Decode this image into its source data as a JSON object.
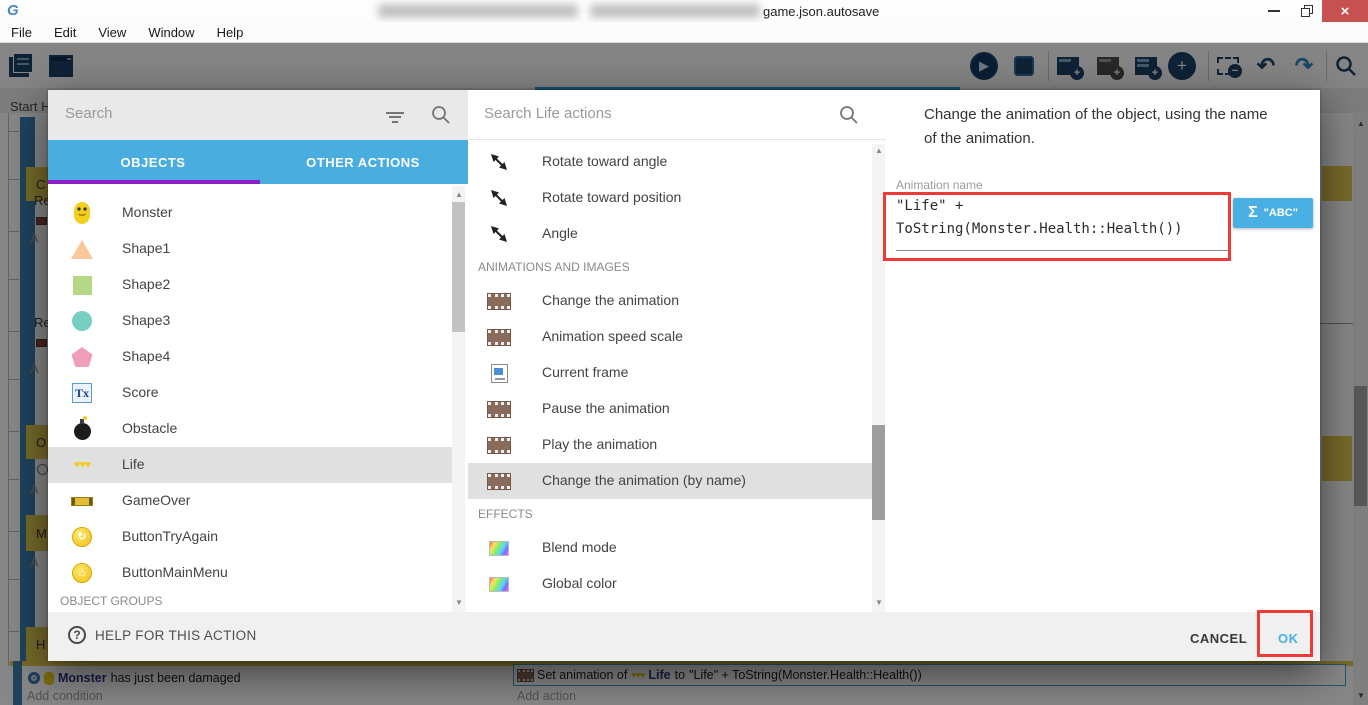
{
  "titlebar": {
    "title_visible": "game.json.autosave"
  },
  "menubar": {
    "items": [
      "File",
      "Edit",
      "View",
      "Window",
      "Help"
    ]
  },
  "toolbar": {
    "icons": [
      "project-manager",
      "scene-editor",
      "play",
      "debug",
      "add-event",
      "add-sub-event",
      "add-comment",
      "add-circle",
      "delete-event",
      "undo",
      "redo",
      "search"
    ]
  },
  "background": {
    "tab_label": "Start H",
    "fragments": {
      "c": "C",
      "re1": "Re",
      "a1": "A",
      "re2": "Re",
      "a2": "A",
      "o": "O",
      "a3": "A",
      "m": "M",
      "a4": "A",
      "h": "H"
    },
    "bottom_event": {
      "condition_object": "Monster",
      "condition_text": "has just been damaged",
      "add_condition": "Add condition",
      "action_prefix": "Set animation of",
      "action_object": "Life",
      "action_to": "to",
      "action_expression": "\"Life\" + ToString(Monster.Health::Health())",
      "add_action": "Add action"
    }
  },
  "dialog": {
    "object_search_placeholder": "Search",
    "tabs": [
      {
        "label": "OBJECTS"
      },
      {
        "label": "OTHER ACTIONS"
      }
    ],
    "objects": [
      {
        "name": "Monster",
        "icon": "monster-sprite"
      },
      {
        "name": "Shape1",
        "icon": "orange-triangle"
      },
      {
        "name": "Shape2",
        "icon": "green-square"
      },
      {
        "name": "Shape3",
        "icon": "teal-circle"
      },
      {
        "name": "Shape4",
        "icon": "pink-pentagon"
      },
      {
        "name": "Score",
        "icon": "text-object"
      },
      {
        "name": "Obstacle",
        "icon": "bomb"
      },
      {
        "name": "Life",
        "icon": "hearts",
        "selected": true
      },
      {
        "name": "GameOver",
        "icon": "banner"
      },
      {
        "name": "ButtonTryAgain",
        "icon": "yellow-button-reload"
      },
      {
        "name": "ButtonMainMenu",
        "icon": "yellow-button-home"
      }
    ],
    "groups_header": "OBJECT GROUPS",
    "action_search_placeholder": "Search Life actions",
    "action_headers": [
      "ANIMATIONS AND IMAGES",
      "EFFECTS"
    ],
    "actions": [
      {
        "label": "Rotate toward angle",
        "icon": "rotate-arrow"
      },
      {
        "label": "Rotate toward position",
        "icon": "rotate-arrow"
      },
      {
        "label": "Angle",
        "icon": "rotate-arrow"
      },
      {
        "label": "Change the animation",
        "icon": "film-strip"
      },
      {
        "label": "Animation speed scale",
        "icon": "film-strip"
      },
      {
        "label": "Current frame",
        "icon": "frame"
      },
      {
        "label": "Pause the animation",
        "icon": "film-strip"
      },
      {
        "label": "Play the animation",
        "icon": "film-strip"
      },
      {
        "label": "Change the animation (by name)",
        "icon": "film-strip",
        "selected": true
      },
      {
        "label": "Blend mode",
        "icon": "rainbow"
      },
      {
        "label": "Global color",
        "icon": "rainbow"
      }
    ],
    "detail": {
      "description": "Change the animation of the object, using the name of the animation.",
      "field_label": "Animation name",
      "field_value": "\"Life\" +\nToString(Monster.Health::Health())",
      "sigma": "Σ",
      "expression_button": "\"ABC\""
    },
    "footer": {
      "help": "HELP FOR THIS ACTION",
      "cancel": "CANCEL",
      "ok": "OK"
    }
  },
  "colors": {
    "accent_blue": "#49ade0",
    "tab_underline_purple": "#8d1fc6",
    "annotation_red": "#ee3b38",
    "ok_blue": "#4ab0e4",
    "selected_gray": "#e0e0e0",
    "close_red": "#c75050",
    "event_yellow": "#e0c84f"
  }
}
